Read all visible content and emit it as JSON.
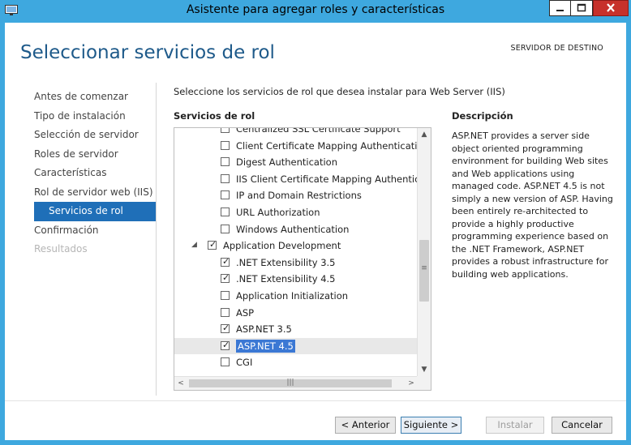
{
  "window": {
    "title": "Asistente para agregar roles y características"
  },
  "header": {
    "page_title": "Seleccionar servicios de rol",
    "destination_label": "SERVIDOR DE DESTINO"
  },
  "nav": {
    "items": [
      {
        "label": "Antes de comenzar",
        "state": "normal"
      },
      {
        "label": "Tipo de instalación",
        "state": "normal"
      },
      {
        "label": "Selección de servidor",
        "state": "normal"
      },
      {
        "label": "Roles de servidor",
        "state": "normal"
      },
      {
        "label": "Características",
        "state": "normal"
      },
      {
        "label": "Rol de servidor web (IIS)",
        "state": "normal"
      },
      {
        "label": "Servicios de rol",
        "state": "active"
      },
      {
        "label": "Confirmación",
        "state": "normal"
      },
      {
        "label": "Resultados",
        "state": "disabled"
      }
    ]
  },
  "main": {
    "instruction": "Seleccione los servicios de rol que desea instalar para Web Server (IIS)",
    "services_label": "Servicios de rol",
    "tree": [
      {
        "label": "Centralized SSL Certificate Support",
        "checked": false,
        "partial": true
      },
      {
        "label": "Client Certificate Mapping Authentication",
        "checked": false
      },
      {
        "label": "Digest Authentication",
        "checked": false
      },
      {
        "label": "IIS Client Certificate Mapping Authentication",
        "checked": false
      },
      {
        "label": "IP and Domain Restrictions",
        "checked": false
      },
      {
        "label": "URL Authorization",
        "checked": false
      },
      {
        "label": "Windows Authentication",
        "checked": false
      },
      {
        "label": "Application Development",
        "checked": true,
        "expanded": true,
        "parent": true
      },
      {
        "label": ".NET Extensibility 3.5",
        "checked": true
      },
      {
        "label": ".NET Extensibility 4.5",
        "checked": true
      },
      {
        "label": "Application Initialization",
        "checked": false
      },
      {
        "label": "ASP",
        "checked": false
      },
      {
        "label": "ASP.NET 3.5",
        "checked": true
      },
      {
        "label": "ASP.NET 4.5",
        "checked": true,
        "selected": true
      },
      {
        "label": "CGI",
        "checked": false
      }
    ]
  },
  "description": {
    "label": "Descripción",
    "text": "ASP.NET provides a server side object oriented programming environment for building Web sites and Web applications using managed code. ASP.NET 4.5 is not simply a new version of ASP. Having been entirely re-architected to provide a highly productive programming experience based on the .NET Framework, ASP.NET provides a robust infrastructure for building web applications."
  },
  "buttons": {
    "previous": "< Anterior",
    "next": "Siguiente >",
    "install": "Instalar",
    "cancel": "Cancelar"
  },
  "colors": {
    "accent": "#1f6fb8",
    "title": "#1e5a8a",
    "frame": "#3ea8df"
  }
}
